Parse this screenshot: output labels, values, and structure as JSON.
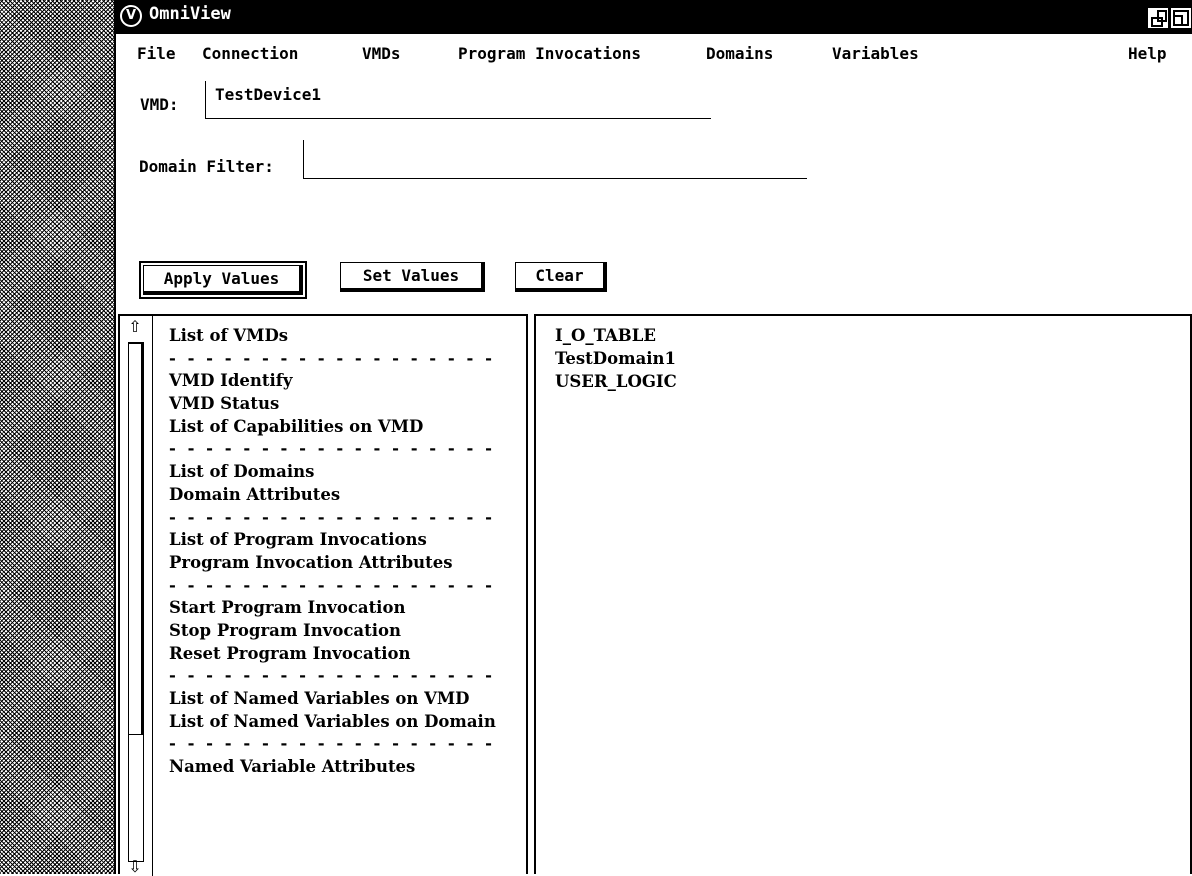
{
  "window": {
    "title": "OmniView"
  },
  "menu": {
    "items": [
      "File",
      "Connection",
      "VMDs",
      "Program Invocations",
      "Domains",
      "Variables"
    ],
    "help": "Help"
  },
  "form": {
    "vmd_label": "VMD:",
    "vmd_value": "TestDevice1",
    "domain_filter_label": "Domain Filter:",
    "domain_filter_value": ""
  },
  "buttons": {
    "apply": "Apply Values",
    "set": "Set Values",
    "clear": "Clear"
  },
  "scrollbar": {
    "up_icon": "up-arrow-icon",
    "down_icon": "down-arrow-icon"
  },
  "services": [
    "List of VMDs",
    "- - - - - - - - - - - - - - - - - -",
    "VMD Identify",
    "VMD Status",
    "List of Capabilities on VMD",
    "- - - - - - - - - - - - - - - - - -",
    "List of Domains",
    "Domain Attributes",
    "- - - - - - - - - - - - - - - - - -",
    "List of Program Invocations",
    "Program Invocation Attributes",
    "- - - - - - - - - - - - - - - - - -",
    "Start Program Invocation",
    "Stop Program Invocation",
    "Reset Program Invocation",
    "- - - - - - - - - - - - - - - - - -",
    "List of Named Variables on VMD",
    "List of Named Variables on Domain",
    "- - - - - - - - - - - - - - - - - -",
    "Named Variable Attributes"
  ],
  "results": [
    "I_O_TABLE",
    "TestDomain1",
    "USER_LOGIC"
  ]
}
